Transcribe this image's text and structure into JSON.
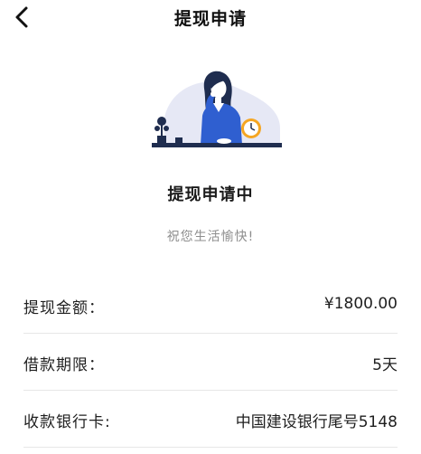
{
  "header": {
    "title": "提现申请"
  },
  "icons": {
    "back": "chevron-left-icon",
    "illustration": "woman-at-desk-with-clock-illustration"
  },
  "status": {
    "title": "提现申请中",
    "subtitle": "祝您生活愉快!"
  },
  "details": [
    {
      "label": "提现金额：",
      "value": "¥1800.00"
    },
    {
      "label": "借款期限：",
      "value": "5天"
    },
    {
      "label": "收款银行卡:",
      "value": "中国建设银行尾号5148"
    }
  ],
  "colors": {
    "accent_blue": "#2f5fd0",
    "clock_orange": "#f5a623",
    "desk_navy": "#1f2d4f",
    "background_lavender": "#e6e8f5",
    "divider": "#e7e7e7"
  }
}
